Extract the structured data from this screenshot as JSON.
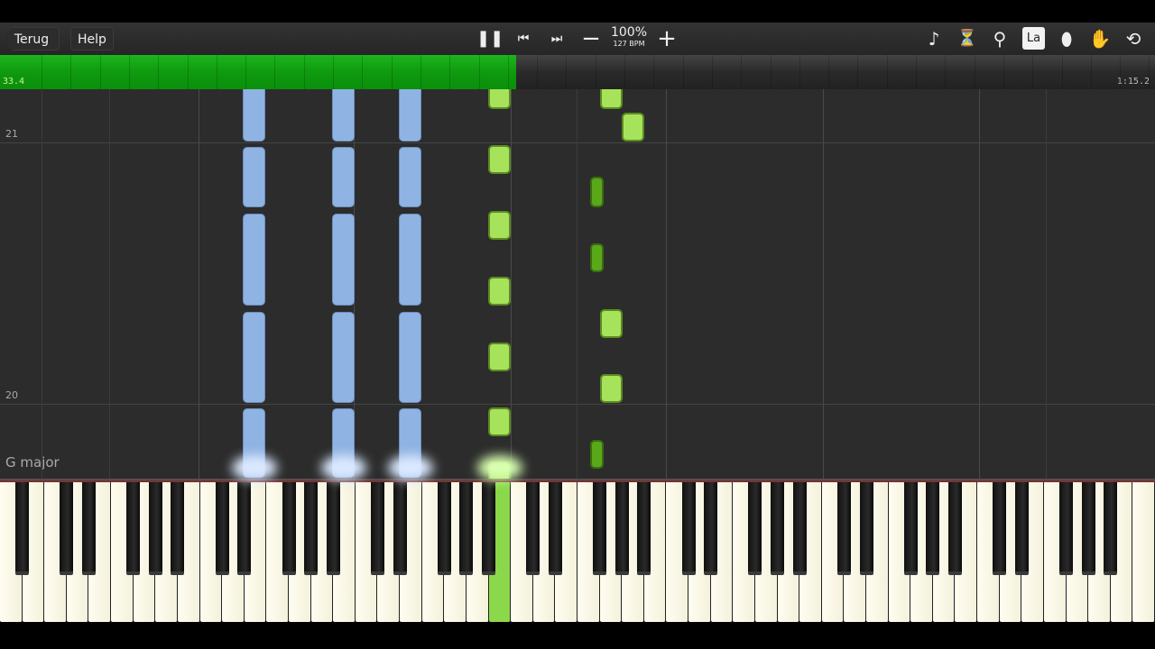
{
  "toolbar": {
    "back_label": "Terug",
    "help_label": "Help",
    "speed": "100%",
    "bpm": "127 BPM",
    "icons": [
      "pause-icon",
      "skip-back-icon",
      "skip-forward-icon",
      "minus-icon",
      "plus-icon",
      "note-icon",
      "metronome-icon",
      "magnifier-icon",
      "note-labels-icon",
      "marker-icon",
      "hand-icon",
      "loop-icon"
    ],
    "label_button": "La"
  },
  "progress": {
    "current": "33.4",
    "total": "1:15.2",
    "fraction": 0.447,
    "color": "#12a312"
  },
  "roll": {
    "measures": [
      {
        "label": "21"
      },
      {
        "label": "20"
      }
    ],
    "key_signature": "G major"
  },
  "colors": {
    "left_hand": "#8fb3e2",
    "right_hand": "#a6e35a",
    "right_hand_black": "#59a81a"
  }
}
